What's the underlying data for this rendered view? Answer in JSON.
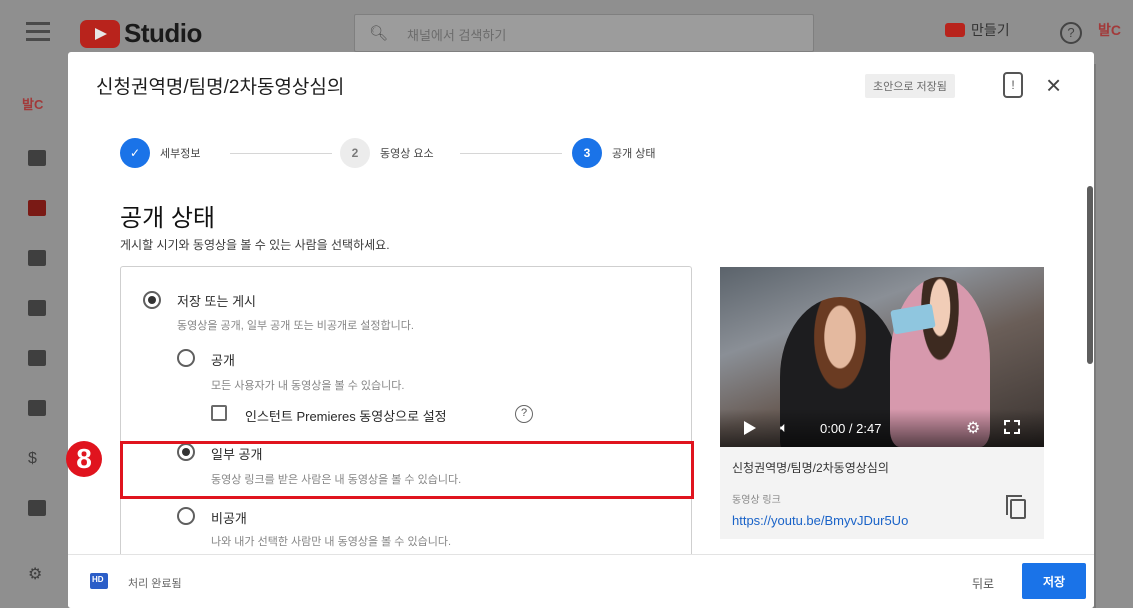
{
  "app": {
    "logo_text": "Studio",
    "search_placeholder": "채널에서 검색하기",
    "create_label": "만들기",
    "help_icon": "?"
  },
  "dialog": {
    "title": "신청권역명/팀명/2차동영상심의",
    "draft_status": "초안으로 저장됨",
    "close_icon": "×",
    "steps": [
      {
        "number": "✓",
        "label": "세부정보"
      },
      {
        "number": "2",
        "label": "동영상 요소"
      },
      {
        "number": "3",
        "label": "공개 상태"
      }
    ],
    "heading": "공개 상태",
    "subheading": "게시할 시기와 동영상을 볼 수 있는 사람을 선택하세요.",
    "options": {
      "save_publish": {
        "label": "저장 또는 게시",
        "desc": "동영상을 공개, 일부 공개 또는 비공개로 설정합니다."
      },
      "public": {
        "label": "공개",
        "desc": "모든 사용자가 내 동영상을 볼 수 있습니다."
      },
      "premiere": {
        "label": "인스턴트 Premieres 동영상으로 설정",
        "help": "?"
      },
      "unlisted": {
        "label": "일부 공개",
        "desc": "동영상 링크를 받은 사람은 내 동영상을 볼 수 있습니다."
      },
      "private": {
        "label": "비공개",
        "desc": "나와 내가 선택한 사람만 내 동영상을 볼 수 있습니다."
      }
    },
    "badge_number": "8",
    "preview": {
      "time": "0:00 / 2:47",
      "video_title": "신청권역명/팀명/2차동영상심의",
      "link_label": "동영상 링크",
      "link": "https://youtu.be/BmyvJDur5Uo"
    },
    "footer": {
      "status": "처리 완료됨",
      "back": "뒤로",
      "save": "저장"
    }
  },
  "colors": {
    "accent": "#1a73e8",
    "highlight": "#e0141e"
  }
}
